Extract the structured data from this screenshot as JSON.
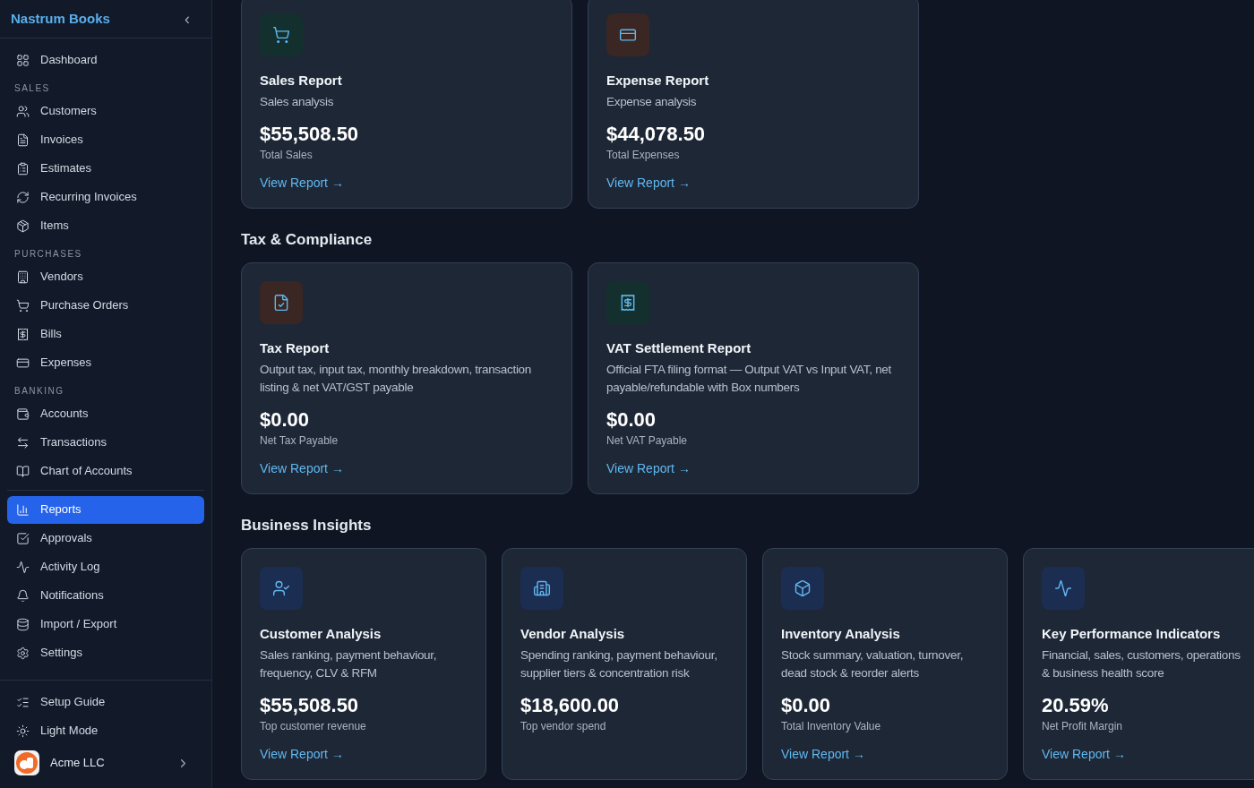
{
  "sidebar": {
    "brand": "Nastrum Books",
    "collapse_icon": "‹",
    "nav": [
      {
        "kind": "item",
        "label": "Dashboard",
        "selected": false
      },
      {
        "kind": "heading",
        "label": "SALES"
      },
      {
        "kind": "item",
        "label": "Customers",
        "selected": false
      },
      {
        "kind": "item",
        "label": "Invoices",
        "selected": false
      },
      {
        "kind": "item",
        "label": "Estimates",
        "selected": false
      },
      {
        "kind": "item",
        "label": "Recurring Invoices",
        "selected": false
      },
      {
        "kind": "item",
        "label": "Items",
        "selected": false
      },
      {
        "kind": "heading",
        "label": "PURCHASES"
      },
      {
        "kind": "item",
        "label": "Vendors",
        "selected": false
      },
      {
        "kind": "item",
        "label": "Purchase Orders",
        "selected": false
      },
      {
        "kind": "item",
        "label": "Bills",
        "selected": false
      },
      {
        "kind": "item",
        "label": "Expenses",
        "selected": false
      },
      {
        "kind": "heading",
        "label": "BANKING"
      },
      {
        "kind": "item",
        "label": "Accounts",
        "selected": false
      },
      {
        "kind": "item",
        "label": "Transactions",
        "selected": false
      },
      {
        "kind": "item",
        "label": "Chart of Accounts",
        "selected": false
      },
      {
        "kind": "divider"
      },
      {
        "kind": "item",
        "label": "Reports",
        "selected": true
      },
      {
        "kind": "item",
        "label": "Approvals",
        "selected": false
      },
      {
        "kind": "item",
        "label": "Activity Log",
        "selected": false
      },
      {
        "kind": "item",
        "label": "Notifications",
        "selected": false
      },
      {
        "kind": "item",
        "label": "Import / Export",
        "selected": false
      },
      {
        "kind": "item",
        "label": "Settings",
        "selected": false
      }
    ],
    "footer": [
      {
        "label": "Setup Guide"
      },
      {
        "label": "Light Mode"
      }
    ],
    "account": {
      "name": "Acme LLC"
    }
  },
  "sections": [
    {
      "cards": [
        {
          "title": "Sales Report",
          "description": "Sales analysis",
          "value": "$55,508.50",
          "caption": "Total Sales",
          "link": "View Report →",
          "color": "#13302e"
        },
        {
          "title": "Expense Report",
          "description": "Expense analysis",
          "value": "$44,078.50",
          "caption": "Total Expenses",
          "link": "View Report →",
          "color": "#3a2622"
        }
      ]
    },
    {
      "title": "Tax & Compliance",
      "cards": [
        {
          "title": "Tax Report",
          "description": "Output tax, input tax, monthly breakdown, transaction listing & net VAT/GST payable",
          "value": "$0.00",
          "caption": "Net Tax Payable",
          "link": "View Report →",
          "color": "#3a2622"
        },
        {
          "title": "VAT Settlement Report",
          "description": "Official FTA filing format — Output VAT vs Input VAT, net payable/refundable with Box numbers",
          "value": "$0.00",
          "caption": "Net VAT Payable",
          "link": "View Report →",
          "color": "#13302e"
        }
      ]
    },
    {
      "title": "Business Insights",
      "cards": [
        {
          "title": "Customer Analysis",
          "description": "Sales ranking, payment behaviour, frequency, CLV & RFM",
          "value": "$55,508.50",
          "caption": "Top customer revenue",
          "link": "View Report →",
          "color": "#1c2d52"
        },
        {
          "title": "Vendor Analysis",
          "description": "Spending ranking, payment behaviour, supplier tiers & concentration risk",
          "value": "$18,600.00",
          "caption": "Top vendor spend",
          "color": "#1c2d52"
        },
        {
          "title": "Inventory Analysis",
          "description": "Stock summary, valuation, turnover, dead stock & reorder alerts",
          "value": "$0.00",
          "caption": "Total Inventory Value",
          "link": "View Report →",
          "color": "#1c2d52"
        },
        {
          "title": "Key Performance Indicators",
          "description": "Financial, sales, customers, operations & business health score",
          "value": "20.59%",
          "caption": "Net Profit Margin",
          "link": "View Report →",
          "color": "#1c2d52"
        }
      ]
    }
  ]
}
